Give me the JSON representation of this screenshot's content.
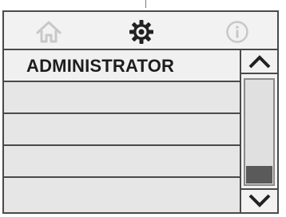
{
  "header": {
    "home_icon": "home-icon",
    "settings_icon": "gear-icon",
    "info_icon": "info-icon"
  },
  "menu": {
    "items": [
      {
        "label": "ADMINISTRATOR"
      },
      {
        "label": ""
      },
      {
        "label": ""
      },
      {
        "label": ""
      },
      {
        "label": ""
      }
    ]
  },
  "scrollbar": {
    "up_icon": "arrow-up-icon",
    "down_icon": "arrow-down-icon",
    "position": 1.0
  },
  "colors": {
    "frame": "#4a4a4a",
    "disabled_icon": "#c8c8c8",
    "active_icon": "#222222",
    "thumb": "#5a5a5a"
  }
}
